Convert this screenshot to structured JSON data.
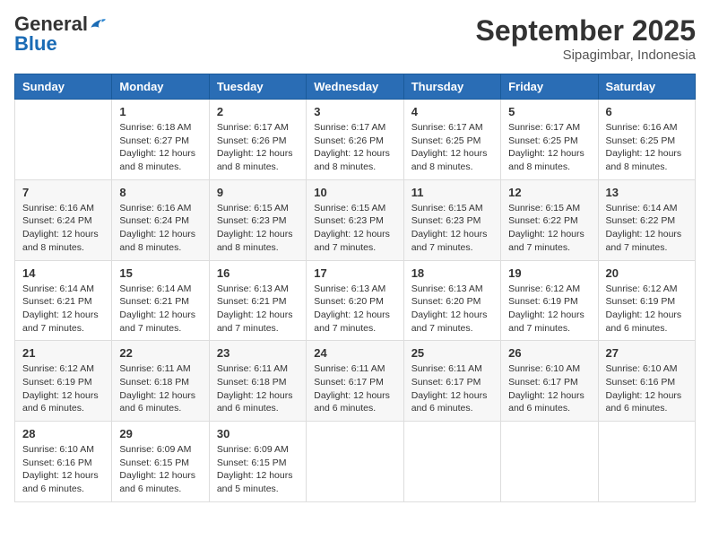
{
  "header": {
    "logo": {
      "general": "General",
      "blue": "Blue"
    },
    "month": "September 2025",
    "location": "Sipagimbar, Indonesia"
  },
  "weekdays": [
    "Sunday",
    "Monday",
    "Tuesday",
    "Wednesday",
    "Thursday",
    "Friday",
    "Saturday"
  ],
  "weeks": [
    [
      {
        "day": "",
        "info": ""
      },
      {
        "day": "1",
        "info": "Sunrise: 6:18 AM\nSunset: 6:27 PM\nDaylight: 12 hours\nand 8 minutes."
      },
      {
        "day": "2",
        "info": "Sunrise: 6:17 AM\nSunset: 6:26 PM\nDaylight: 12 hours\nand 8 minutes."
      },
      {
        "day": "3",
        "info": "Sunrise: 6:17 AM\nSunset: 6:26 PM\nDaylight: 12 hours\nand 8 minutes."
      },
      {
        "day": "4",
        "info": "Sunrise: 6:17 AM\nSunset: 6:25 PM\nDaylight: 12 hours\nand 8 minutes."
      },
      {
        "day": "5",
        "info": "Sunrise: 6:17 AM\nSunset: 6:25 PM\nDaylight: 12 hours\nand 8 minutes."
      },
      {
        "day": "6",
        "info": "Sunrise: 6:16 AM\nSunset: 6:25 PM\nDaylight: 12 hours\nand 8 minutes."
      }
    ],
    [
      {
        "day": "7",
        "info": "Sunrise: 6:16 AM\nSunset: 6:24 PM\nDaylight: 12 hours\nand 8 minutes."
      },
      {
        "day": "8",
        "info": "Sunrise: 6:16 AM\nSunset: 6:24 PM\nDaylight: 12 hours\nand 8 minutes."
      },
      {
        "day": "9",
        "info": "Sunrise: 6:15 AM\nSunset: 6:23 PM\nDaylight: 12 hours\nand 8 minutes."
      },
      {
        "day": "10",
        "info": "Sunrise: 6:15 AM\nSunset: 6:23 PM\nDaylight: 12 hours\nand 7 minutes."
      },
      {
        "day": "11",
        "info": "Sunrise: 6:15 AM\nSunset: 6:23 PM\nDaylight: 12 hours\nand 7 minutes."
      },
      {
        "day": "12",
        "info": "Sunrise: 6:15 AM\nSunset: 6:22 PM\nDaylight: 12 hours\nand 7 minutes."
      },
      {
        "day": "13",
        "info": "Sunrise: 6:14 AM\nSunset: 6:22 PM\nDaylight: 12 hours\nand 7 minutes."
      }
    ],
    [
      {
        "day": "14",
        "info": "Sunrise: 6:14 AM\nSunset: 6:21 PM\nDaylight: 12 hours\nand 7 minutes."
      },
      {
        "day": "15",
        "info": "Sunrise: 6:14 AM\nSunset: 6:21 PM\nDaylight: 12 hours\nand 7 minutes."
      },
      {
        "day": "16",
        "info": "Sunrise: 6:13 AM\nSunset: 6:21 PM\nDaylight: 12 hours\nand 7 minutes."
      },
      {
        "day": "17",
        "info": "Sunrise: 6:13 AM\nSunset: 6:20 PM\nDaylight: 12 hours\nand 7 minutes."
      },
      {
        "day": "18",
        "info": "Sunrise: 6:13 AM\nSunset: 6:20 PM\nDaylight: 12 hours\nand 7 minutes."
      },
      {
        "day": "19",
        "info": "Sunrise: 6:12 AM\nSunset: 6:19 PM\nDaylight: 12 hours\nand 7 minutes."
      },
      {
        "day": "20",
        "info": "Sunrise: 6:12 AM\nSunset: 6:19 PM\nDaylight: 12 hours\nand 6 minutes."
      }
    ],
    [
      {
        "day": "21",
        "info": "Sunrise: 6:12 AM\nSunset: 6:19 PM\nDaylight: 12 hours\nand 6 minutes."
      },
      {
        "day": "22",
        "info": "Sunrise: 6:11 AM\nSunset: 6:18 PM\nDaylight: 12 hours\nand 6 minutes."
      },
      {
        "day": "23",
        "info": "Sunrise: 6:11 AM\nSunset: 6:18 PM\nDaylight: 12 hours\nand 6 minutes."
      },
      {
        "day": "24",
        "info": "Sunrise: 6:11 AM\nSunset: 6:17 PM\nDaylight: 12 hours\nand 6 minutes."
      },
      {
        "day": "25",
        "info": "Sunrise: 6:11 AM\nSunset: 6:17 PM\nDaylight: 12 hours\nand 6 minutes."
      },
      {
        "day": "26",
        "info": "Sunrise: 6:10 AM\nSunset: 6:17 PM\nDaylight: 12 hours\nand 6 minutes."
      },
      {
        "day": "27",
        "info": "Sunrise: 6:10 AM\nSunset: 6:16 PM\nDaylight: 12 hours\nand 6 minutes."
      }
    ],
    [
      {
        "day": "28",
        "info": "Sunrise: 6:10 AM\nSunset: 6:16 PM\nDaylight: 12 hours\nand 6 minutes."
      },
      {
        "day": "29",
        "info": "Sunrise: 6:09 AM\nSunset: 6:15 PM\nDaylight: 12 hours\nand 6 minutes."
      },
      {
        "day": "30",
        "info": "Sunrise: 6:09 AM\nSunset: 6:15 PM\nDaylight: 12 hours\nand 5 minutes."
      },
      {
        "day": "",
        "info": ""
      },
      {
        "day": "",
        "info": ""
      },
      {
        "day": "",
        "info": ""
      },
      {
        "day": "",
        "info": ""
      }
    ]
  ]
}
